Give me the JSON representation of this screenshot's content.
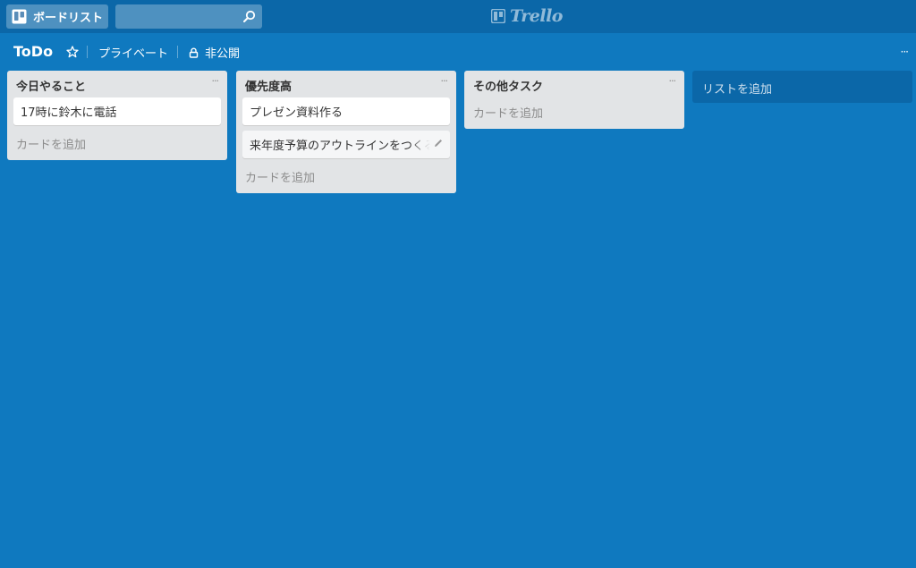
{
  "header": {
    "boards_label": "ボードリスト",
    "search": {
      "value": "",
      "placeholder": ""
    },
    "logo_text": "Trello"
  },
  "board": {
    "title": "ToDo",
    "privacy": "プライベート",
    "visibility": "非公開",
    "menu": "···"
  },
  "lists": [
    {
      "title": "今日やること",
      "menu": "···",
      "cards": [
        "17時に鈴木に電話"
      ],
      "add_card": "カードを追加"
    },
    {
      "title": "優先度高",
      "menu": "···",
      "cards": [
        "プレゼン資料作る",
        "来年度予算のアウトラインをつくる"
      ],
      "add_card": "カードを追加"
    },
    {
      "title": "その他タスク",
      "menu": "···",
      "cards": [],
      "add_card": "カードを追加"
    }
  ],
  "add_list_label": "リストを追加",
  "colors": {
    "board_bg": "#0f79bf",
    "header_bg": "#0b67a8",
    "list_bg": "#e2e4e6"
  },
  "icons": [
    "boards-icon",
    "search-icon",
    "trello-logo-icon",
    "star-icon",
    "lock-icon",
    "pencil-icon"
  ]
}
